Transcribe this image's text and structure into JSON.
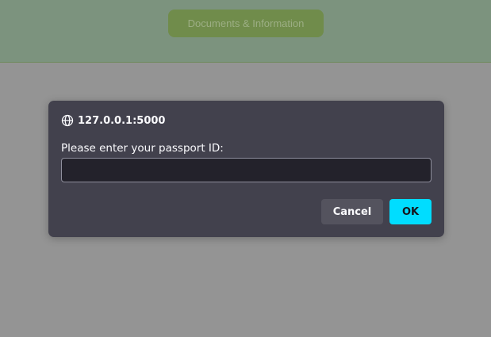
{
  "page": {
    "nav_button_label": "Documents & Information"
  },
  "dialog": {
    "origin": "127.0.0.1:5000",
    "origin_icon": "globe-icon",
    "prompt": "Please enter your passport ID:",
    "input_value": "",
    "cancel_label": "Cancel",
    "ok_label": "OK"
  },
  "colors": {
    "accent": "#00ddff",
    "dialog_bg": "#42414d",
    "header_bg": "#7c937e"
  }
}
